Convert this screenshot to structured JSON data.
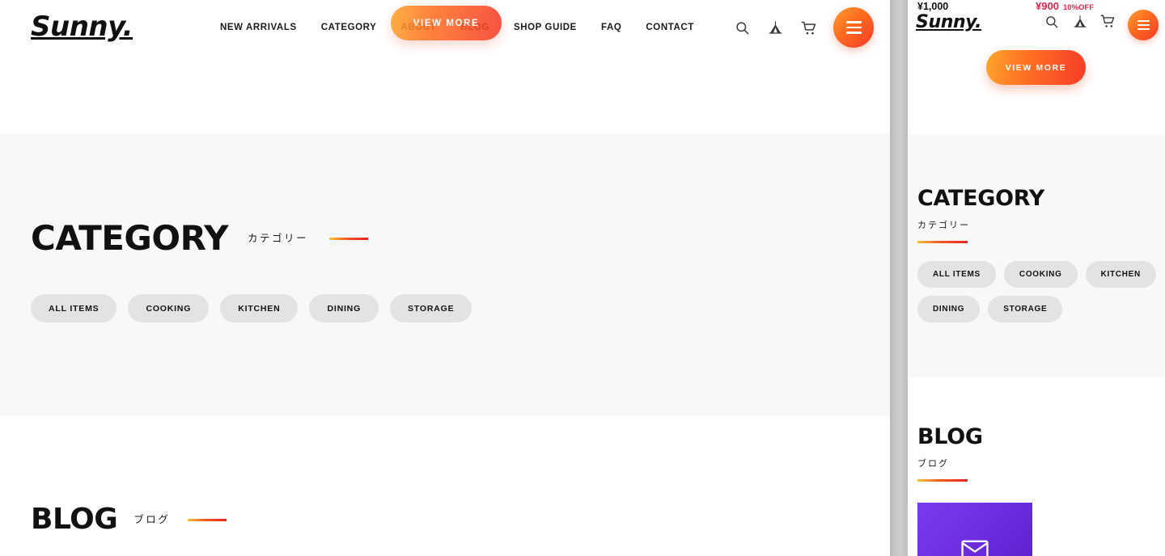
{
  "desktop": {
    "brand": "Sunny.",
    "nav": [
      {
        "label": "NEW ARRIVALS"
      },
      {
        "label": "CATEGORY"
      },
      {
        "label": "ABOUT"
      },
      {
        "label": "BLOG"
      },
      {
        "label": "SHOP GUIDE"
      },
      {
        "label": "FAQ"
      },
      {
        "label": "CONTACT"
      }
    ],
    "icons": {
      "search": "search-icon",
      "tent": "tent-icon",
      "cart": "cart-icon",
      "menu": "hamburger-icon"
    },
    "view_more": "VIEW MORE",
    "category_section": {
      "title_en": "CATEGORY",
      "title_jp": "カテゴリー",
      "pills": [
        "ALL ITEMS",
        "COOKING",
        "KITCHEN",
        "DINING",
        "STORAGE"
      ]
    },
    "blog_section": {
      "title_en": "BLOG",
      "title_jp": "ブログ"
    }
  },
  "mobile": {
    "brand": "Sunny.",
    "price_original": "¥1,000",
    "price_sale": "¥900",
    "discount_badge": "10%OFF",
    "view_more": "VIEW MORE",
    "category_section": {
      "title_en": "CATEGORY",
      "title_jp": "カテゴリー",
      "pills": [
        "ALL ITEMS",
        "COOKING",
        "KITCHEN",
        "DINING",
        "STORAGE"
      ]
    },
    "blog_section": {
      "title_en": "BLOG",
      "title_jp": "ブログ"
    }
  },
  "colors": {
    "accent_orange": "#ff8a2b",
    "accent_red": "#f63a28",
    "sale_red": "#e8244b",
    "section_bg": "#f8f8f8",
    "pill_bg": "#e3e3e3",
    "blog_card_purple": "#6d2de0"
  }
}
